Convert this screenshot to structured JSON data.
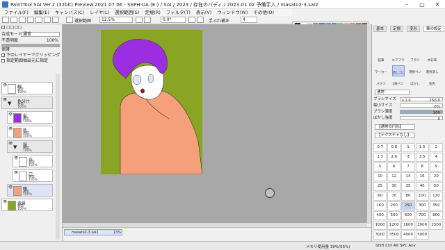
{
  "window": {
    "title": "PaintTool SAI Ver.2 (32bit) Preview.2021.07.06 - SSPH-UA (E:) / SAI / 2023 / 存在のバディ / 2023.01.02 予備手入 / masato2-3.sai2",
    "minimize": "–",
    "maximize": "□",
    "close": "✕"
  },
  "menu": [
    "ファイル(F)",
    "編集(E)",
    "キャンバス(C)",
    "レイヤ(L)",
    "選択範囲(S)",
    "定規(R)",
    "フィルタ(T)",
    "表示(V)",
    "ウィンドウ(W)",
    "その他(O)"
  ],
  "toolbar": {
    "select_label": "選択範囲",
    "zoom": "12.5%",
    "angle": "0.0°",
    "stabilizer_label": "手ぶれ補正",
    "stabilizer": "4"
  },
  "leftpanel": {
    "draw_mode_label": "合成モード",
    "draw_mode": "通常",
    "opacity_label": "不透明度",
    "opacity": "100%",
    "protect_label": "保護",
    "clip_label": "下のレイヤーでクリッピング",
    "sel_source_label": "指定範囲抽出元に指定",
    "layers": [
      {
        "name": "線",
        "mode": "通常",
        "opacity": "100%"
      },
      {
        "name": "色分け",
        "mode": "通常",
        "opacity": "100%"
      },
      {
        "name": "髪",
        "mode": "通常",
        "opacity": "100%"
      },
      {
        "name": "肌",
        "mode": "通常",
        "opacity": "100%"
      },
      {
        "name": "服",
        "mode": "通常",
        "opacity": "100%"
      },
      {
        "name": "白",
        "mode": "通常",
        "opacity": "100%"
      },
      {
        "name": "口",
        "mode": "通常",
        "opacity": "100%"
      },
      {
        "name": "瞳",
        "mode": "通常",
        "opacity": "100%"
      },
      {
        "name": "背景",
        "mode": "通常",
        "opacity": "100%"
      }
    ]
  },
  "docbar": {
    "filename": "masato2-3.sai2",
    "zoom": "13%"
  },
  "toolpanel": {
    "tabs": [
      "基本",
      "定規",
      "変形",
      "筆の設定"
    ],
    "tools": [
      "鉛筆",
      "エアブラシ",
      "ブラシ",
      "水彩筆",
      "マーカー",
      "消しゴム",
      "選択ペン",
      "選択消し",
      "バケツ",
      "2値ペン",
      "ぼかし",
      "指先"
    ],
    "brush_mode": "通常",
    "brush_size_label": "ブラシサイズ",
    "brush_size_mult": "x 1.0",
    "brush_size": "250.0",
    "min_size_label": "最小サイズ",
    "min_size": "0%",
    "density_label": "ブラシ濃度",
    "density": "100",
    "blur_label": "ぼかし強度",
    "blur": "0",
    "shape_label": "【通常の円形】",
    "texture_label": "【テクスチャなし】",
    "sizes": [
      "0.7",
      "0.8",
      "1",
      "1.5",
      "2",
      "2.3",
      "2.6",
      "3",
      "3.5",
      "4",
      "5",
      "6",
      "7",
      "8",
      "9",
      "10",
      "12",
      "14",
      "16",
      "20",
      "25",
      "30",
      "35",
      "40",
      "50",
      "60",
      "70",
      "80",
      "100",
      "120",
      "160",
      "200",
      "250",
      "300",
      "350",
      "400",
      "500",
      "600",
      "700",
      "800",
      "1000",
      "1200",
      "1600",
      "2000",
      "2500",
      "3000",
      "3500",
      "4000",
      "5000"
    ],
    "selected_size": "250"
  },
  "status": {
    "memory": "メモリ使用量 19%(55%)",
    "keys": "Shift Ctrl Alt SPC Any"
  }
}
